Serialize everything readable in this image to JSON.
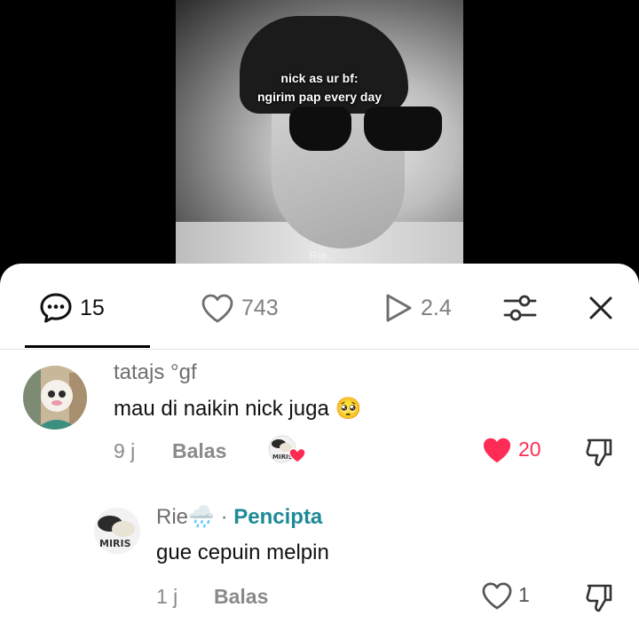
{
  "video": {
    "caption_line1": "nick as ur bf:",
    "caption_line2": "ngirim pap every day",
    "watermark": "Rie."
  },
  "tabs": {
    "comments_count": "15",
    "likes_count": "743",
    "plays_count": "2.4"
  },
  "comments": [
    {
      "username": "tatajs °gf",
      "text": "mau di naikin nick juga",
      "emoji": "🥺",
      "time": "9 j",
      "reply_label": "Balas",
      "likes": "20",
      "liked": true,
      "creator_liked": true,
      "creator_avatar_text": "MIRIS"
    },
    {
      "username": "Rie",
      "username_emoji": "🌧️",
      "separator": "·",
      "badge": "Pencipta",
      "text": "gue cepuin melpin",
      "time": "1 j",
      "reply_label": "Balas",
      "likes": "1",
      "liked": false,
      "avatar_text": "MIRIS"
    }
  ],
  "colors": {
    "like_red": "#fe2c55",
    "creator_teal": "#1e8a96"
  }
}
